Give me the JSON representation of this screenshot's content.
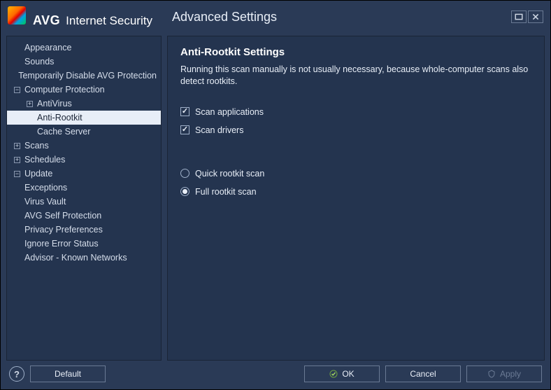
{
  "header": {
    "brand_prefix": "AVG",
    "brand_suffix": "Internet Security",
    "section_title": "Advanced Settings"
  },
  "sidebar": {
    "items": [
      {
        "label": "Appearance",
        "indent": 0,
        "expander": ""
      },
      {
        "label": "Sounds",
        "indent": 0,
        "expander": ""
      },
      {
        "label": "Temporarily Disable AVG Protection",
        "indent": 0,
        "expander": ""
      },
      {
        "label": "Computer Protection",
        "indent": 0,
        "expander": "−"
      },
      {
        "label": "AntiVirus",
        "indent": 1,
        "expander": "+"
      },
      {
        "label": "Anti-Rootkit",
        "indent": 1,
        "expander": "",
        "selected": true
      },
      {
        "label": "Cache Server",
        "indent": 1,
        "expander": ""
      },
      {
        "label": "Scans",
        "indent": 0,
        "expander": "+"
      },
      {
        "label": "Schedules",
        "indent": 0,
        "expander": "+"
      },
      {
        "label": "Update",
        "indent": 0,
        "expander": "−"
      },
      {
        "label": "Exceptions",
        "indent": 0,
        "expander": ""
      },
      {
        "label": "Virus Vault",
        "indent": 0,
        "expander": ""
      },
      {
        "label": "AVG Self Protection",
        "indent": 0,
        "expander": ""
      },
      {
        "label": "Privacy Preferences",
        "indent": 0,
        "expander": ""
      },
      {
        "label": "Ignore Error Status",
        "indent": 0,
        "expander": ""
      },
      {
        "label": "Advisor - Known Networks",
        "indent": 0,
        "expander": ""
      }
    ]
  },
  "main": {
    "heading": "Anti-Rootkit Settings",
    "description": "Running this scan manually is not usually necessary, because whole-computer scans also detect rootkits.",
    "checkboxes": [
      {
        "label": "Scan applications",
        "checked": true
      },
      {
        "label": "Scan drivers",
        "checked": true
      }
    ],
    "radios": [
      {
        "label": "Quick rootkit scan",
        "checked": false
      },
      {
        "label": "Full rootkit scan",
        "checked": true
      }
    ]
  },
  "footer": {
    "default_label": "Default",
    "ok_label": "OK",
    "cancel_label": "Cancel",
    "apply_label": "Apply"
  }
}
